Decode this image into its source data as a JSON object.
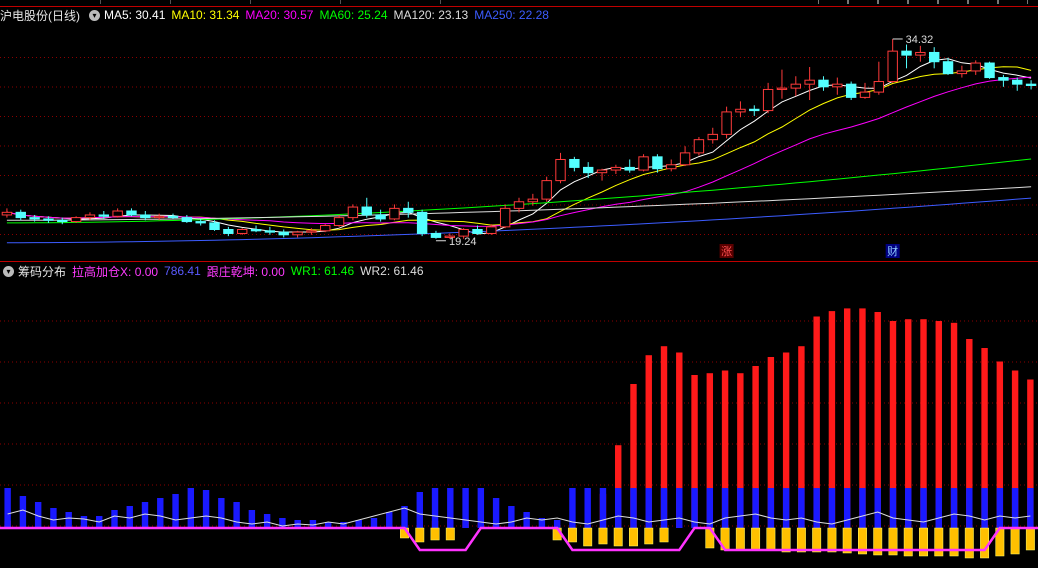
{
  "header": {
    "stock_title": "沪电股份(日线)",
    "ma": [
      {
        "label": "MA5: 30.41",
        "color": "#ffffff"
      },
      {
        "label": "MA10: 31.34",
        "color": "#ffff00"
      },
      {
        "label": "MA20: 30.57",
        "color": "#ff00ff"
      },
      {
        "label": "MA60: 25.24",
        "color": "#00ff00"
      },
      {
        "label": "MA120: 23.13",
        "color": "#dddddd"
      },
      {
        "label": "MA250: 22.28",
        "color": "#3c5cff"
      }
    ]
  },
  "indicator": {
    "title": "筹码分布",
    "items": [
      {
        "label": "拉高加仓X: 0.00",
        "color": "#ff3bff"
      },
      {
        "label": "786.41",
        "color": "#5a5aff"
      },
      {
        "label": "跟庄乾坤: 0.00",
        "color": "#ff3bff"
      },
      {
        "label": "WR1: 61.46",
        "color": "#00ff00"
      },
      {
        "label": "WR2: 61.46",
        "color": "#dddddd"
      }
    ]
  },
  "annotations": {
    "high": "34.32",
    "low": "19.24"
  },
  "events": [
    {
      "label": "涨",
      "color": "#ff5050",
      "bg": "#5a0000",
      "index": 52
    },
    {
      "label": "财",
      "color": "#8cc8ff",
      "bg": "#000080",
      "index": 64
    }
  ],
  "colors": {
    "up": "#ff3b3b",
    "down": "#54ffff",
    "grid": "#8b0000",
    "divider": "#c00000"
  },
  "chart_data": [
    {
      "type": "candlestick",
      "title": "沪电股份(日线)",
      "ohlc": [
        [
          21.0,
          21.5,
          20.8,
          21.2
        ],
        [
          21.2,
          21.4,
          20.6,
          20.8
        ],
        [
          20.8,
          21.0,
          20.5,
          20.7
        ],
        [
          20.7,
          20.9,
          20.4,
          20.6
        ],
        [
          20.6,
          20.8,
          20.3,
          20.5
        ],
        [
          20.5,
          20.9,
          20.4,
          20.8
        ],
        [
          20.8,
          21.2,
          20.6,
          21.0
        ],
        [
          21.0,
          21.3,
          20.7,
          20.9
        ],
        [
          20.9,
          21.5,
          20.8,
          21.3
        ],
        [
          21.3,
          21.5,
          20.9,
          21.0
        ],
        [
          21.0,
          21.3,
          20.6,
          20.8
        ],
        [
          20.8,
          21.1,
          20.6,
          20.9
        ],
        [
          20.9,
          21.1,
          20.7,
          20.8
        ],
        [
          20.8,
          21.0,
          20.4,
          20.5
        ],
        [
          20.5,
          20.7,
          20.2,
          20.4
        ],
        [
          20.4,
          20.6,
          19.8,
          19.9
        ],
        [
          19.9,
          20.1,
          19.4,
          19.6
        ],
        [
          19.6,
          20.0,
          19.5,
          19.9
        ],
        [
          19.9,
          20.2,
          19.7,
          19.8
        ],
        [
          19.8,
          20.1,
          19.5,
          19.7
        ],
        [
          19.7,
          19.9,
          19.3,
          19.5
        ],
        [
          19.5,
          19.8,
          19.3,
          19.7
        ],
        [
          19.7,
          20.0,
          19.5,
          19.8
        ],
        [
          19.8,
          20.3,
          19.7,
          20.2
        ],
        [
          20.2,
          21.0,
          20.1,
          20.8
        ],
        [
          20.8,
          21.8,
          20.6,
          21.6
        ],
        [
          21.6,
          22.3,
          20.8,
          21.0
        ],
        [
          21.0,
          21.4,
          20.5,
          20.7
        ],
        [
          20.7,
          21.8,
          20.6,
          21.5
        ],
        [
          21.5,
          22.0,
          20.8,
          21.2
        ],
        [
          21.2,
          21.4,
          19.4,
          19.6
        ],
        [
          19.6,
          19.8,
          19.2,
          19.3
        ],
        [
          19.3,
          19.6,
          19.2,
          19.4
        ],
        [
          19.4,
          20.0,
          19.2,
          19.9
        ],
        [
          19.9,
          20.2,
          19.5,
          19.6
        ],
        [
          19.6,
          20.3,
          19.5,
          20.1
        ],
        [
          20.1,
          21.8,
          20.0,
          21.5
        ],
        [
          21.5,
          22.3,
          21.2,
          22.0
        ],
        [
          22.0,
          22.6,
          21.7,
          22.2
        ],
        [
          22.2,
          23.9,
          22.0,
          23.6
        ],
        [
          23.6,
          25.7,
          23.4,
          25.2
        ],
        [
          25.2,
          25.4,
          24.3,
          24.6
        ],
        [
          24.6,
          25.0,
          23.8,
          24.2
        ],
        [
          24.2,
          24.5,
          23.6,
          24.4
        ],
        [
          24.4,
          24.8,
          24.1,
          24.6
        ],
        [
          24.6,
          25.2,
          24.2,
          24.4
        ],
        [
          24.4,
          25.6,
          24.3,
          25.4
        ],
        [
          25.4,
          25.6,
          24.2,
          24.5
        ],
        [
          24.5,
          25.2,
          24.3,
          24.8
        ],
        [
          24.8,
          26.2,
          24.7,
          25.7
        ],
        [
          25.7,
          26.9,
          25.5,
          26.7
        ],
        [
          26.7,
          27.6,
          26.4,
          27.1
        ],
        [
          27.1,
          29.2,
          26.8,
          28.8
        ],
        [
          28.8,
          29.6,
          28.4,
          29.0
        ],
        [
          29.0,
          29.3,
          28.5,
          28.9
        ],
        [
          28.9,
          31.0,
          28.7,
          30.5
        ],
        [
          30.5,
          32.0,
          29.8,
          30.6
        ],
        [
          30.6,
          31.5,
          30.0,
          30.9
        ],
        [
          30.9,
          32.2,
          29.7,
          31.2
        ],
        [
          31.2,
          31.5,
          30.4,
          30.7
        ],
        [
          30.7,
          31.4,
          30.1,
          30.9
        ],
        [
          30.9,
          31.1,
          29.7,
          29.9
        ],
        [
          29.9,
          31.0,
          29.8,
          30.3
        ],
        [
          30.3,
          32.6,
          30.1,
          31.1
        ],
        [
          31.1,
          34.32,
          31.0,
          33.4
        ],
        [
          33.4,
          33.9,
          32.1,
          33.1
        ],
        [
          33.1,
          33.8,
          32.6,
          33.3
        ],
        [
          33.3,
          33.7,
          32.1,
          32.6
        ],
        [
          32.6,
          32.9,
          31.6,
          31.7
        ],
        [
          31.7,
          32.3,
          31.4,
          31.9
        ],
        [
          31.9,
          32.7,
          31.6,
          32.5
        ],
        [
          32.5,
          32.6,
          31.3,
          31.4
        ],
        [
          31.4,
          31.6,
          30.7,
          31.2
        ],
        [
          31.2,
          31.4,
          30.4,
          30.9
        ],
        [
          30.9,
          31.2,
          30.5,
          30.8
        ]
      ],
      "ma_values": {
        "MA5": 30.41,
        "MA10": 31.34,
        "MA20": 30.57,
        "MA60": 25.24,
        "MA120": 23.13,
        "MA250": 22.28
      },
      "ylim": [
        18.5,
        35.0
      ]
    },
    {
      "type": "bar",
      "title": "筹码分布",
      "red": [
        8,
        0,
        0,
        0,
        0,
        0,
        0,
        0,
        0,
        0,
        0,
        0,
        0,
        0,
        0,
        0,
        0,
        0,
        0,
        0,
        0,
        0,
        0,
        0,
        0,
        0,
        0,
        0,
        8,
        14,
        10,
        5,
        0,
        0,
        0,
        0,
        0,
        0,
        0,
        38,
        92,
        160,
        192,
        202,
        195,
        170,
        172,
        175,
        172,
        180,
        190,
        195,
        202,
        235,
        241,
        244,
        244,
        240,
        230,
        232,
        232,
        230,
        228,
        210,
        200,
        185,
        175,
        165
      ],
      "blue": [
        40,
        32,
        26,
        20,
        16,
        12,
        12,
        18,
        22,
        26,
        30,
        34,
        40,
        38,
        30,
        26,
        18,
        14,
        10,
        8,
        8,
        6,
        6,
        8,
        10,
        16,
        22,
        36,
        40,
        40,
        40,
        40,
        30,
        22,
        16,
        10,
        8,
        40,
        40,
        40,
        40,
        40,
        40,
        40,
        40,
        40,
        40,
        40,
        40,
        40,
        40,
        40,
        40,
        40,
        40,
        40,
        40,
        40,
        40,
        40,
        40,
        40,
        40,
        40,
        40,
        40,
        40,
        40
      ],
      "yellow": [
        0,
        0,
        0,
        0,
        0,
        0,
        0,
        0,
        0,
        0,
        0,
        0,
        0,
        0,
        0,
        0,
        0,
        0,
        0,
        0,
        0,
        0,
        0,
        0,
        0,
        0,
        10,
        14,
        12,
        12,
        0,
        0,
        0,
        0,
        0,
        0,
        12,
        14,
        18,
        16,
        18,
        18,
        16,
        14,
        0,
        0,
        20,
        22,
        22,
        22,
        22,
        24,
        24,
        24,
        24,
        25,
        26,
        27,
        27,
        28,
        28,
        28,
        28,
        30,
        30,
        28,
        26,
        22
      ],
      "white_line": [
        14,
        18,
        12,
        8,
        10,
        9,
        6,
        12,
        10,
        14,
        12,
        8,
        10,
        12,
        10,
        6,
        4,
        6,
        2,
        4,
        3,
        6,
        4,
        8,
        12,
        16,
        20,
        14,
        12,
        10,
        8,
        6,
        4,
        6,
        10,
        8,
        10,
        6,
        4,
        8,
        12,
        10,
        6,
        8,
        10,
        6,
        4,
        10,
        12,
        14,
        10,
        8,
        10,
        6,
        4,
        8,
        12,
        16,
        10,
        8,
        6,
        10,
        14,
        12,
        8,
        12,
        10,
        12
      ],
      "magenta_lower": [
        0,
        0,
        0,
        0,
        0,
        0,
        0,
        0,
        0,
        0,
        0,
        0,
        0,
        0,
        0,
        0,
        0,
        0,
        0,
        0,
        0,
        0,
        0,
        0,
        0,
        0,
        0,
        22,
        22,
        22,
        22,
        0,
        0,
        0,
        0,
        0,
        0,
        22,
        22,
        22,
        22,
        22,
        22,
        22,
        22,
        0,
        0,
        22,
        22,
        22,
        22,
        22,
        22,
        22,
        22,
        22,
        22,
        22,
        22,
        22,
        22,
        22,
        22,
        22,
        22,
        0,
        0,
        0
      ]
    }
  ]
}
